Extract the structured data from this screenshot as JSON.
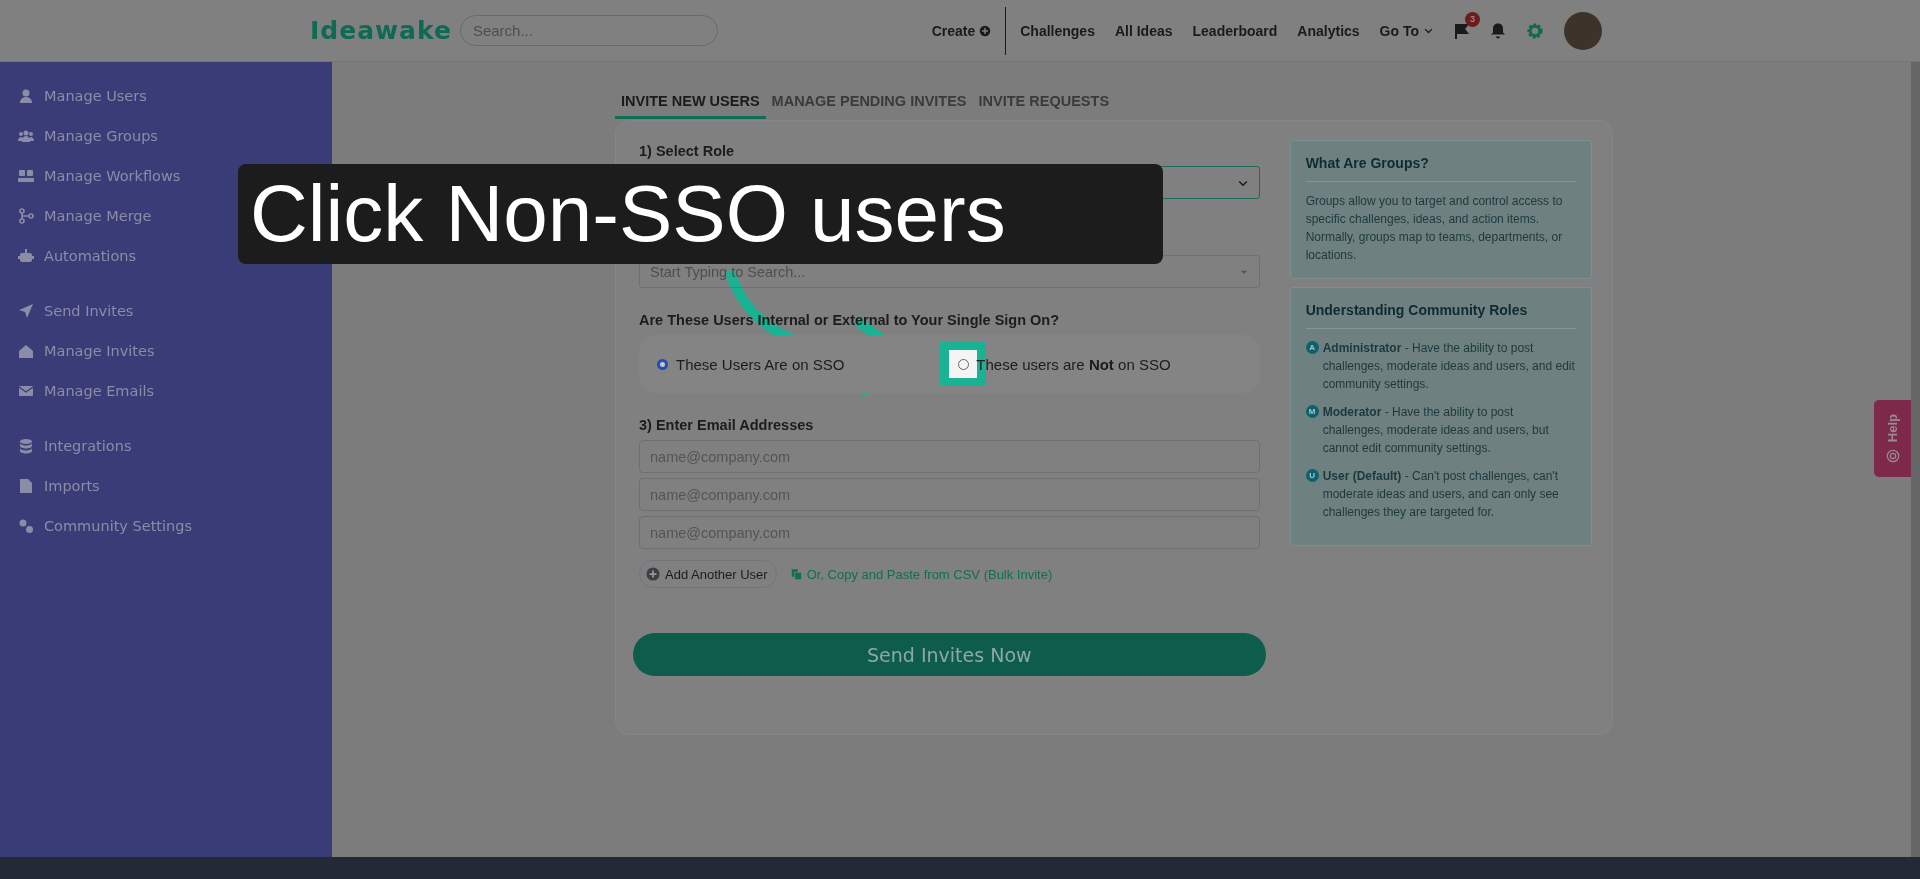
{
  "header": {
    "logo": "Ideawake",
    "search": {
      "placeholder": "Search..."
    },
    "nav": [
      {
        "label": "Create",
        "kind": "create"
      },
      {
        "label": "Challenges",
        "kind": "link"
      },
      {
        "label": "All Ideas",
        "kind": "link"
      },
      {
        "label": "Leaderboard",
        "kind": "link"
      },
      {
        "label": "Analytics",
        "kind": "link"
      },
      {
        "label": "Go To",
        "kind": "dropdown"
      }
    ],
    "flag_badge": "3"
  },
  "sidebar": {
    "groups": [
      {
        "items": [
          {
            "label": "Manage Users"
          },
          {
            "label": "Manage Groups"
          },
          {
            "label": "Manage Workflows"
          },
          {
            "label": "Manage Merge"
          },
          {
            "label": "Automations"
          }
        ]
      },
      {
        "items": [
          {
            "label": "Send Invites"
          },
          {
            "label": "Manage Invites"
          },
          {
            "label": "Manage Emails"
          }
        ]
      },
      {
        "items": [
          {
            "label": "Integrations"
          },
          {
            "label": "Imports"
          },
          {
            "label": "Community Settings"
          }
        ]
      }
    ]
  },
  "tabs": [
    {
      "label": "INVITE NEW USERS",
      "selected": true
    },
    {
      "label": "MANAGE PENDING INVITES",
      "selected": false
    },
    {
      "label": "INVITE REQUESTS",
      "selected": false
    }
  ],
  "form": {
    "role": {
      "label": "1) Select Role"
    },
    "groups": {
      "placeholder": "Start Typing to Search..."
    },
    "sso": {
      "question": "Are These Users Internal or External to Your Single Sign On?",
      "options": [
        {
          "label": "These Users Are on SSO",
          "selected": true,
          "highlighted": false
        },
        {
          "label": "These users are **Not** on SSO",
          "selected": false,
          "highlighted": true
        }
      ]
    },
    "emails": {
      "label": "3) Enter Email Addresses",
      "fields": [
        {
          "placeholder": "name@company.com"
        },
        {
          "placeholder": "name@company.com"
        },
        {
          "placeholder": "name@company.com"
        }
      ]
    },
    "add_button": "Add Another User",
    "csv_link": "Or, Copy and Paste from CSV (Bulk Invite)",
    "submit": "Send Invites Now"
  },
  "info_panels": [
    {
      "title": "What Are Groups?",
      "text": "Groups allow you to target and control access to specific challenges, ideas, and action items. Normally, groups map to teams, departments, or locations."
    },
    {
      "title": "Understanding Community Roles",
      "roles": [
        {
          "badge": "A",
          "text": "**Administrator** - Have the ability to post challenges, moderate ideas and users, and edit community settings."
        },
        {
          "badge": "M",
          "text": "**Moderator** - Have the ability to post challenges, moderate ideas and users, but cannot edit community settings."
        },
        {
          "badge": "U",
          "text": "**User (Default)** - Can't post challenges, can't moderate ideas and users, and can only see challenges they are targeted for."
        }
      ]
    }
  ],
  "help_tab": "Help",
  "callout": {
    "text": "Click Non-SSO users"
  }
}
